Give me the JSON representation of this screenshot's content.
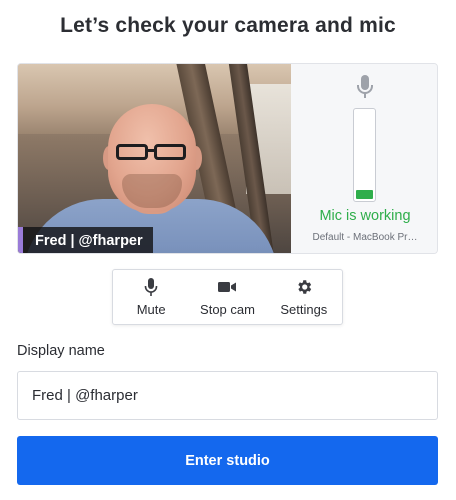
{
  "page": {
    "title": "Let’s check your camera and mic"
  },
  "preview": {
    "participant_label": "Fred | @fharper",
    "mic": {
      "icon": "microphone-icon",
      "level": 0.1,
      "status": "Mic is working",
      "device": "Default - MacBook Pr…",
      "status_color": "#2fae4b"
    }
  },
  "controls": [
    {
      "label": "Mute",
      "icon": "microphone-icon"
    },
    {
      "label": "Stop cam",
      "icon": "video-camera-icon"
    },
    {
      "label": "Settings",
      "icon": "gear-icon"
    }
  ],
  "display_name": {
    "label": "Display name",
    "value": "Fred | @fharper"
  },
  "enter_button": {
    "label": "Enter studio",
    "color": "#1468ee"
  }
}
